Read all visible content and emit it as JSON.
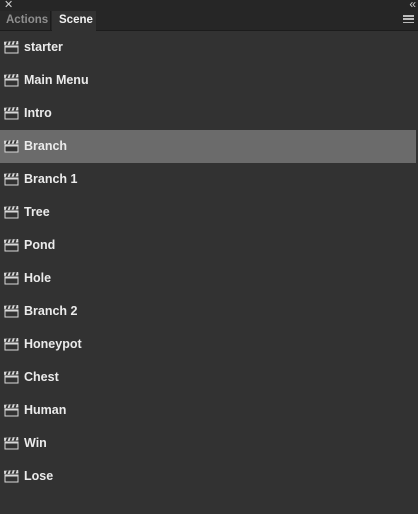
{
  "panel": {
    "collapse_glyph": "«"
  },
  "tabs": [
    {
      "label": "Actions",
      "active": false
    },
    {
      "label": "Scene",
      "active": true
    }
  ],
  "scenes": [
    {
      "label": "starter",
      "icon": "clapperboard-icon",
      "selected": false
    },
    {
      "label": "Main Menu",
      "icon": "clapperboard-icon",
      "selected": false
    },
    {
      "label": "Intro",
      "icon": "clapperboard-icon",
      "selected": false
    },
    {
      "label": "Branch",
      "icon": "clapperboard-icon",
      "selected": true
    },
    {
      "label": "Branch 1",
      "icon": "clapperboard-icon",
      "selected": false
    },
    {
      "label": "Tree",
      "icon": "clapperboard-icon",
      "selected": false
    },
    {
      "label": "Pond",
      "icon": "clapperboard-icon",
      "selected": false
    },
    {
      "label": "Hole",
      "icon": "clapperboard-icon",
      "selected": false
    },
    {
      "label": "Branch 2",
      "icon": "clapperboard-icon",
      "selected": false
    },
    {
      "label": "Honeypot",
      "icon": "clapperboard-icon",
      "selected": false
    },
    {
      "label": "Chest",
      "icon": "clapperboard-icon",
      "selected": false
    },
    {
      "label": "Human",
      "icon": "clapperboard-icon",
      "selected": false
    },
    {
      "label": "Win",
      "icon": "clapperboard-icon",
      "selected": false
    },
    {
      "label": "Lose",
      "icon": "clapperboard-icon",
      "selected": false
    }
  ],
  "colors": {
    "panel_bg": "#323232",
    "selected_row": "#6b6b6b",
    "text": "#ebebeb"
  }
}
